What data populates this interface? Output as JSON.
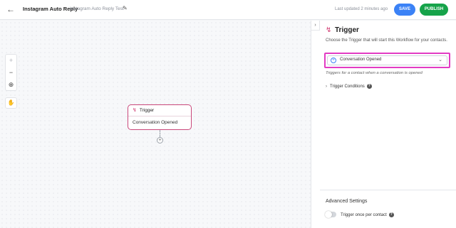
{
  "header": {
    "back_icon": "arrow-left-icon",
    "workflow_name": "Instagram Auto Reply",
    "workflow_subtitle": "Instagram Auto Reply Test",
    "edit_icon": "pencil-icon",
    "last_updated": "Last updated 2 minutes ago",
    "save_label": "SAVE",
    "publish_label": "PUBLISH",
    "save_color": "#3b82f6",
    "publish_color": "#16a34a"
  },
  "canvas": {
    "zoom_in_icon": "plus-icon",
    "zoom_out_icon": "minus-icon",
    "recenter_icon": "crosshair-icon",
    "pan_icon": "hand-icon",
    "node": {
      "title": "Trigger",
      "body": "Conversation Opened",
      "icon": "bolt-icon"
    },
    "add_icon": "plus-circle-icon"
  },
  "panel": {
    "title": "Trigger",
    "description": "Choose the Trigger that will start this Workflow for your contacts.",
    "selected_trigger": "Conversation Opened",
    "helper_text": "Triggers for a contact when a conversation is opened",
    "conditions_label": "Trigger Conditions",
    "advanced_label": "Advanced Settings",
    "trigger_once_label": "Trigger once per contact",
    "trigger_once_enabled": false,
    "highlight_color": "#e23bc3",
    "accent_color": "#d0376f"
  }
}
